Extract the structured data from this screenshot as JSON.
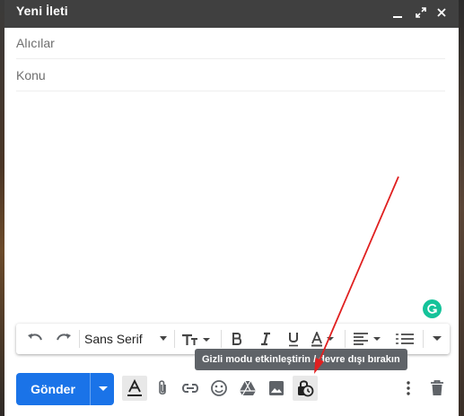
{
  "window": {
    "title": "Yeni İleti",
    "controls": [
      "minimize-icon",
      "expand-icon",
      "close-icon"
    ]
  },
  "fields": {
    "to_placeholder": "Alıcılar",
    "subject_placeholder": "Konu"
  },
  "format_toolbar": {
    "font": "Sans Serif",
    "buttons": [
      "undo-icon",
      "redo-icon",
      "font-select",
      "text-size-icon",
      "bold-icon",
      "italic-icon",
      "underline-icon",
      "text-color-icon",
      "align-icon",
      "numbered-list-icon",
      "more-formatting-icon"
    ]
  },
  "tooltip": {
    "text": "Gizli modu etkinleştirin / devre dışı bırakın"
  },
  "actions": {
    "send_label": "Gönder",
    "buttons": [
      "formatting-options-icon",
      "attach-icon",
      "link-icon",
      "emoji-icon",
      "drive-icon",
      "photo-icon",
      "confidential-mode-icon",
      "more-options-icon",
      "discard-icon"
    ]
  },
  "colors": {
    "titlebar": "#404040",
    "send": "#1a73e8",
    "tooltip": "#5f6368",
    "annotation_arrow": "#e02020",
    "grammarly": "#15c39a"
  }
}
